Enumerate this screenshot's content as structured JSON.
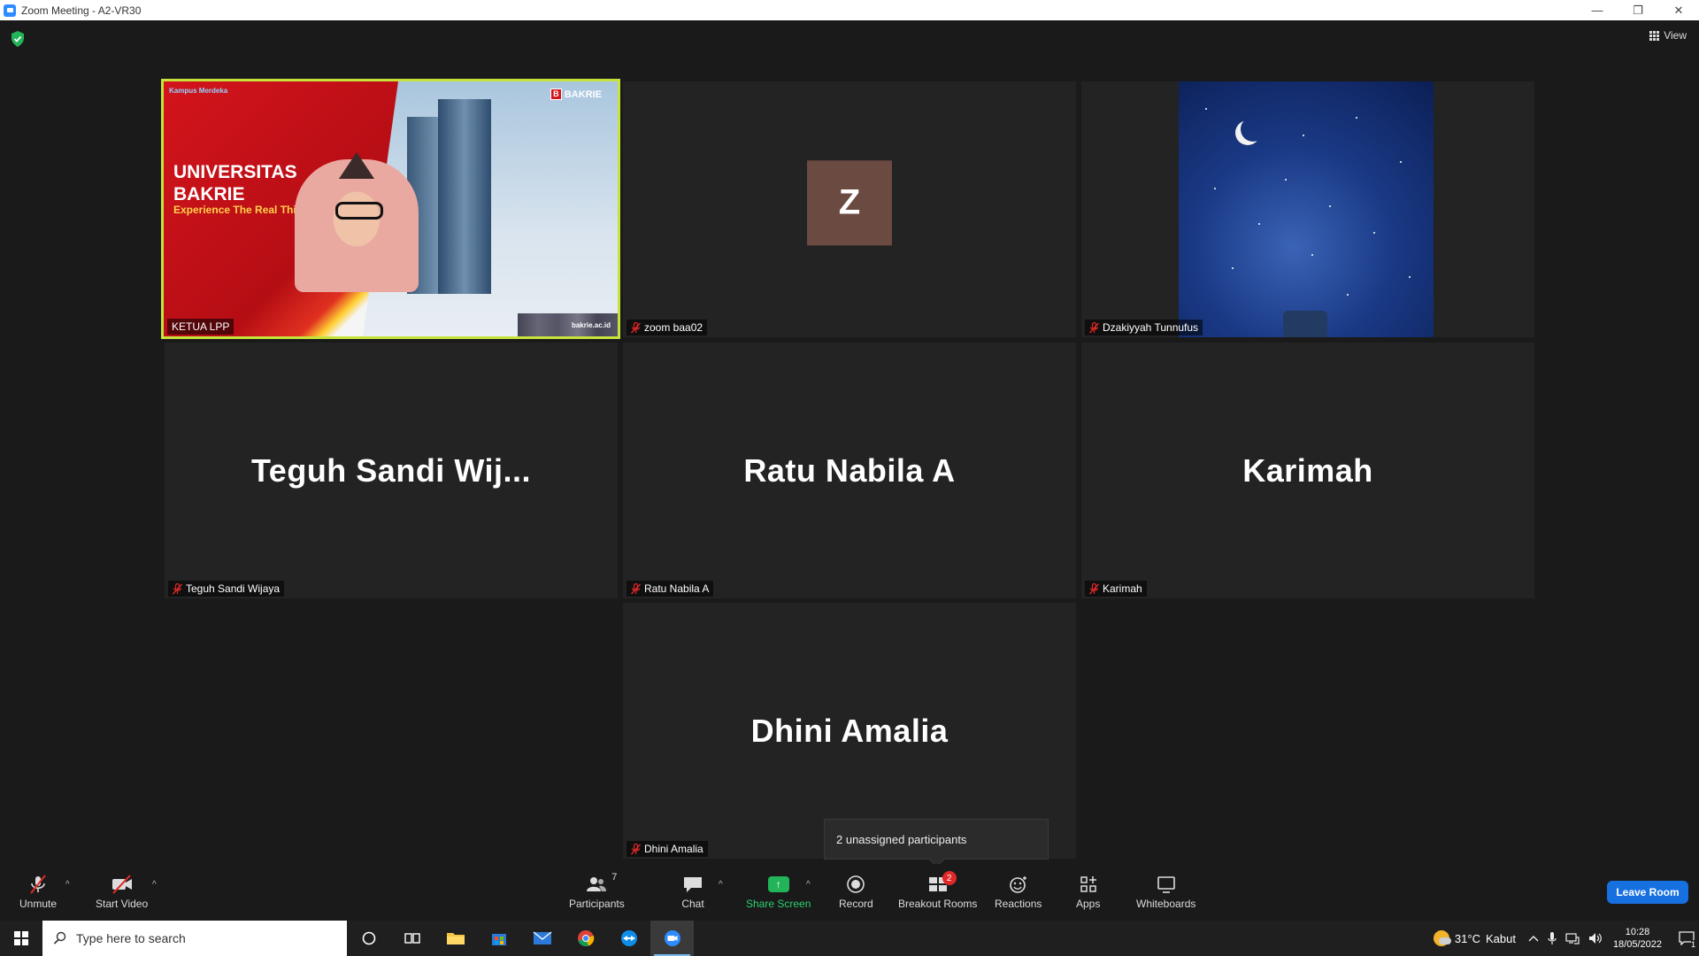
{
  "window": {
    "title": "Zoom Meeting - A2-VR30",
    "minimize": "—",
    "restore": "❐",
    "close": "✕"
  },
  "meeting": {
    "view_label": "View",
    "security_icon": "shield-check-icon",
    "tiles": [
      {
        "name": "KETUA LPP",
        "type": "video",
        "active": true,
        "muted": false
      },
      {
        "name": "zoom baa02",
        "type": "avatar",
        "avatar_letter": "Z",
        "muted": true
      },
      {
        "name": "Dzakiyyah Tunnufus",
        "type": "video",
        "muted": true
      },
      {
        "name": "Teguh Sandi Wijaya",
        "display_name": "Teguh  Sandi  Wij...",
        "type": "name",
        "muted": true
      },
      {
        "name": "Ratu Nabila A",
        "display_name": "Ratu Nabila A",
        "type": "name",
        "muted": true
      },
      {
        "name": "Karimah",
        "display_name": "Karimah",
        "type": "name",
        "muted": true
      },
      {
        "name": "Dhini Amalia",
        "display_name": "Dhini Amalia",
        "type": "name",
        "muted": true
      }
    ],
    "slide": {
      "title_line1": "UNIVERSITAS",
      "title_line2": "BAKRIE",
      "tagline": "Experience The Real Things",
      "brand": "BAKRIE",
      "brand_letter": "B",
      "corner": "Kampus Merdeka",
      "url": "bakrie.ac.id"
    },
    "tooltip": "2 unassigned participants"
  },
  "toolbar": {
    "unmute": "Unmute",
    "start_video": "Start Video",
    "participants": "Participants",
    "participants_count": "7",
    "chat": "Chat",
    "share_screen": "Share Screen",
    "record": "Record",
    "breakout_rooms": "Breakout Rooms",
    "breakout_badge": "2",
    "reactions": "Reactions",
    "apps": "Apps",
    "whiteboards": "Whiteboards",
    "leave": "Leave Room",
    "caret": "^"
  },
  "taskbar": {
    "search_placeholder": "Type here to search",
    "weather_temp": "31°C",
    "weather_desc": "Kabut",
    "time": "10:28",
    "date": "18/05/2022",
    "notification_count": "1",
    "apps": [
      "cortana-icon",
      "task-view-icon",
      "file-explorer-icon",
      "store-icon",
      "mail-icon",
      "chrome-icon",
      "teamviewer-icon",
      "zoom-icon"
    ]
  },
  "colors": {
    "active_border": "#c6e33b",
    "share_green": "#23b45a",
    "leave_blue": "#1670e0",
    "badge_red": "#e02828",
    "avatar_brown": "#6b4a41"
  }
}
